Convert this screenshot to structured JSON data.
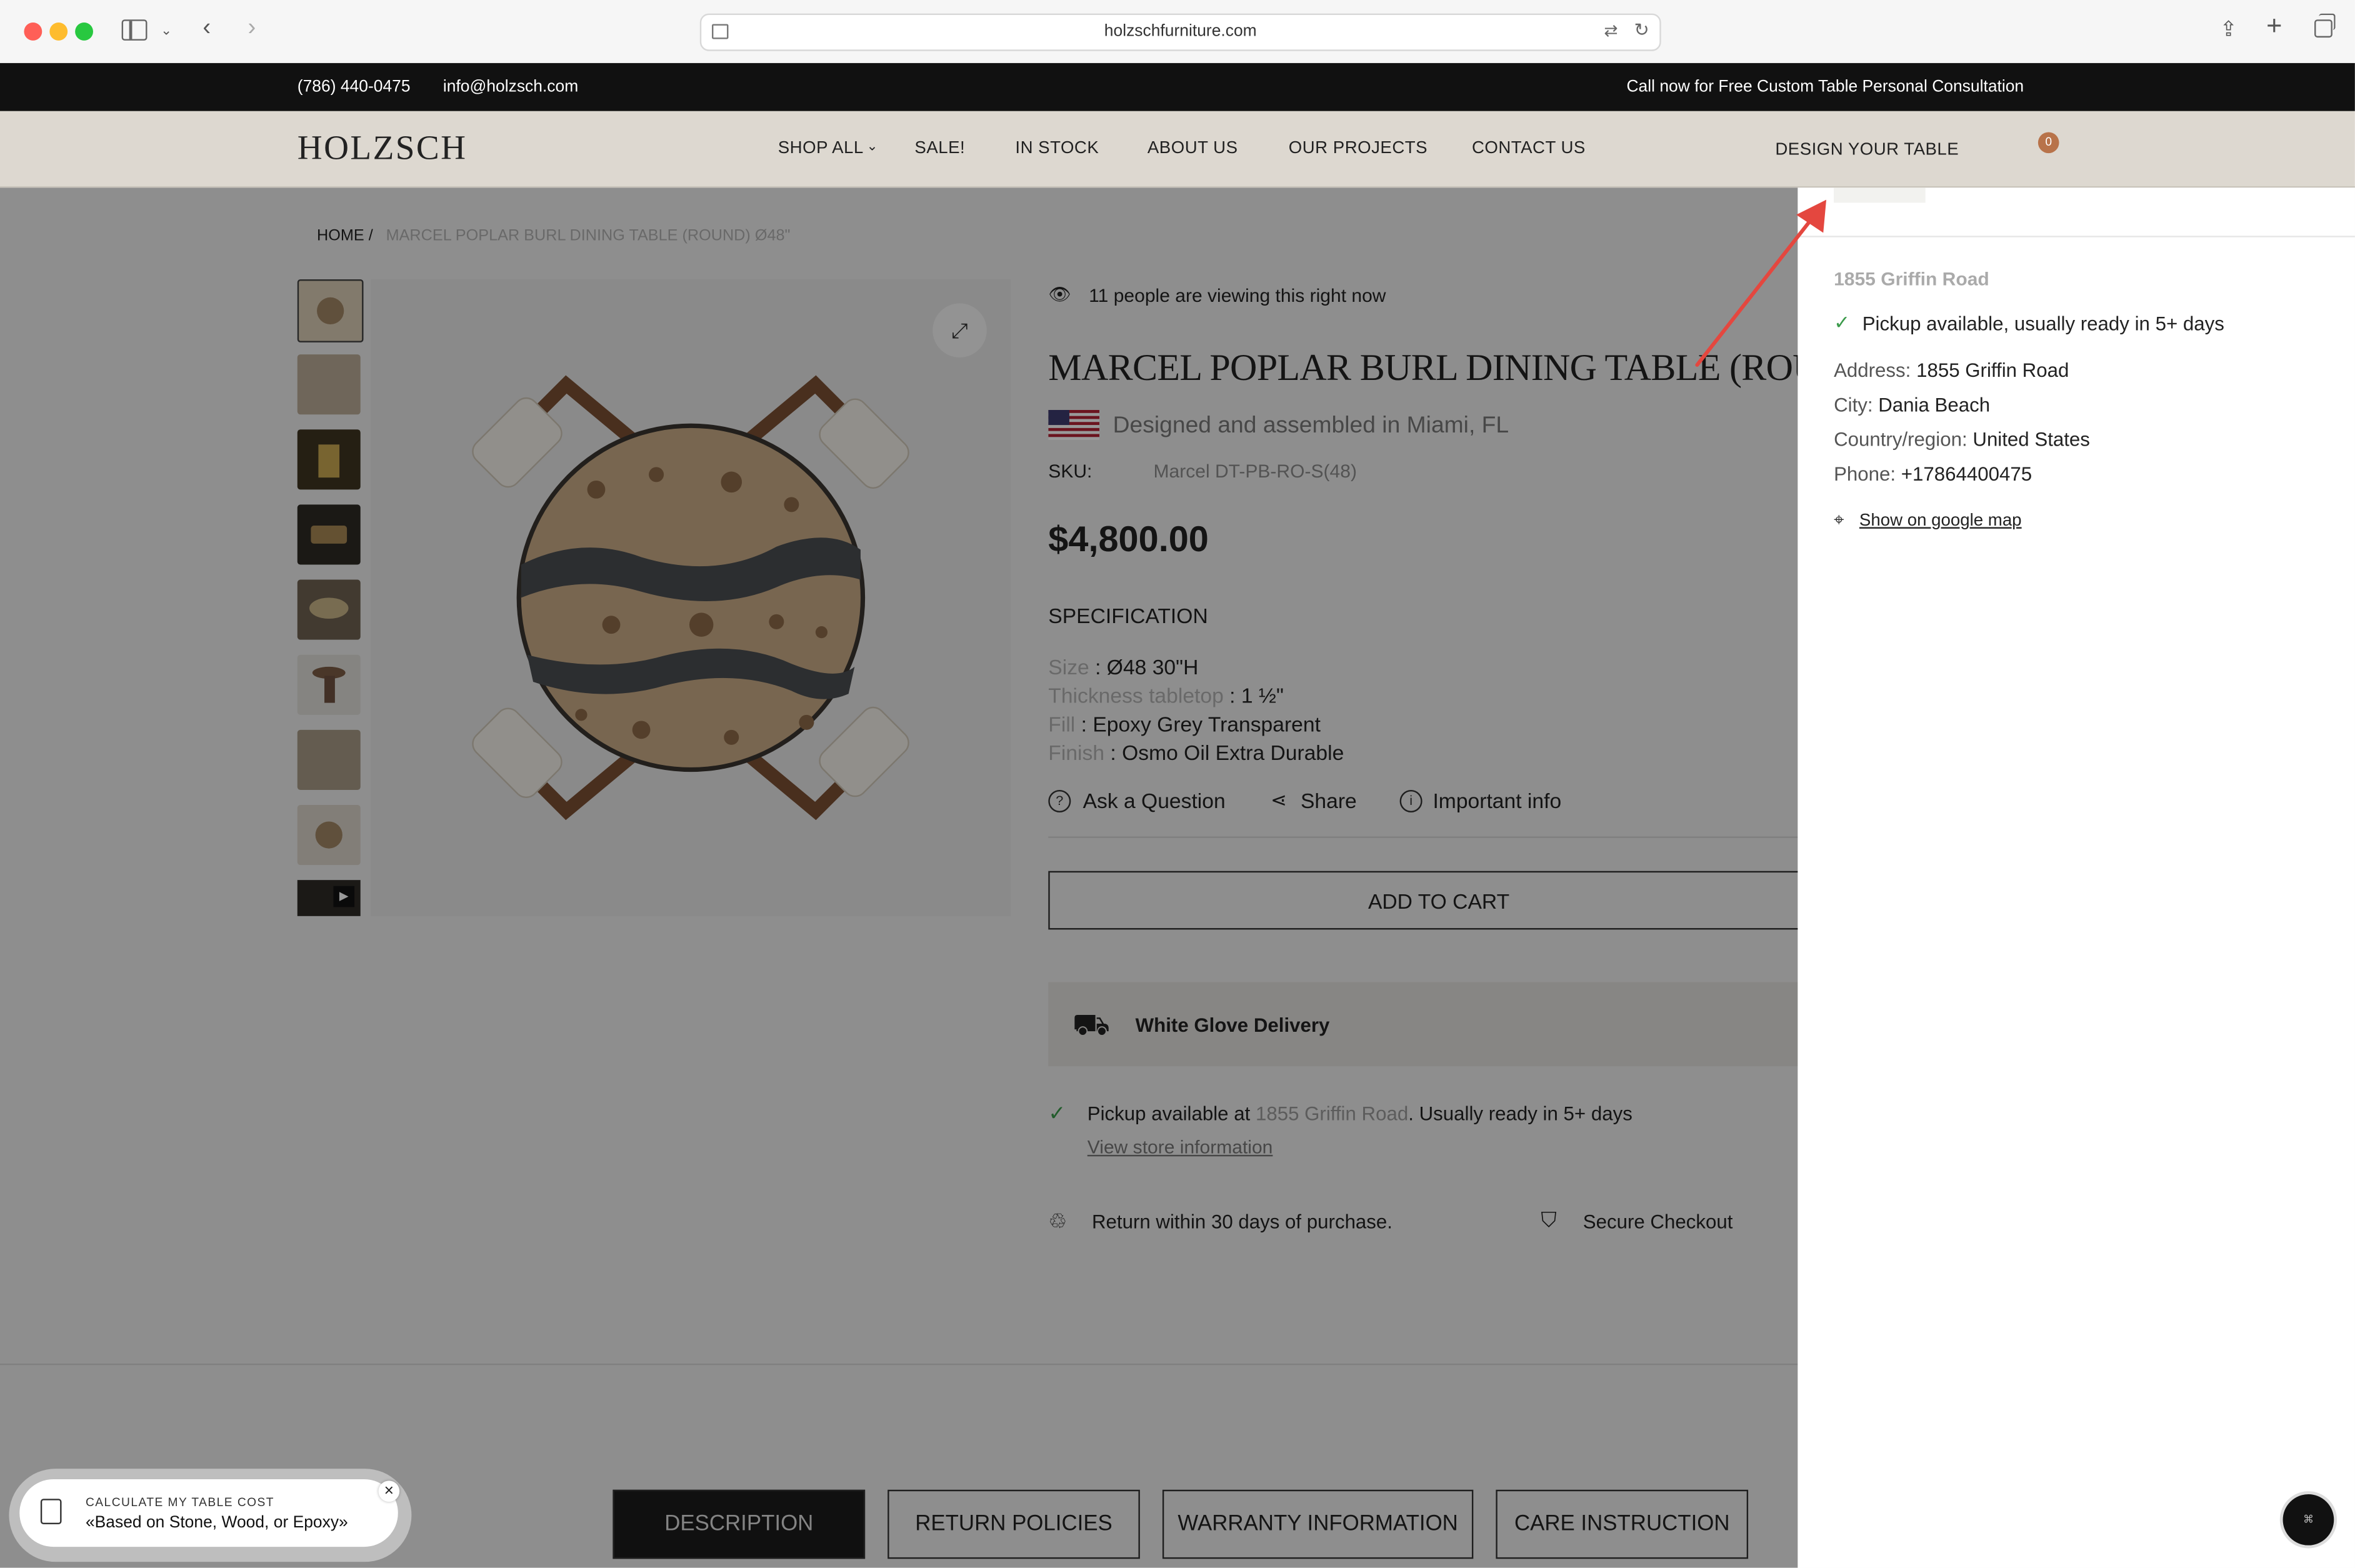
{
  "browser": {
    "url": "holzschfurniture.com"
  },
  "topbar": {
    "phone": "(786) 440-0475",
    "email": "info@holzsch.com",
    "promo": "Call now for Free Custom Table Personal Consultation"
  },
  "nav": {
    "logo": "HOLZSCH",
    "links": [
      "SHOP ALL",
      "SALE!",
      "IN STOCK",
      "ABOUT US",
      "OUR PROJECTS",
      "CONTACT US"
    ],
    "design": "DESIGN YOUR TABLE",
    "cart_count": "0"
  },
  "breadcrumb": {
    "home": "HOME /",
    "current": "MARCEL POPLAR BURL DINING TABLE (ROUND) Ø48\""
  },
  "product": {
    "viewing": "11 people are viewing this right now",
    "title": "MARCEL POPLAR BURL DINING TABLE (ROUND",
    "origin": "Designed and assembled in Miami, FL",
    "sku_label": "SKU:",
    "sku": "Marcel DT-PB-RO-S(48)",
    "price": "$4,800.00",
    "spec_heading": "SPECIFICATION",
    "specs": [
      {
        "label": "Size",
        "value": " : Ø48 30\"H"
      },
      {
        "label": "Thickness tabletop",
        "value": " : 1 ½\""
      },
      {
        "label": "Fill",
        "value": " : Epoxy Grey Transparent"
      },
      {
        "label": "Finish",
        "value": " : Osmo Oil Extra Durable"
      }
    ],
    "actions": [
      "Ask a Question",
      "Share",
      "Important info"
    ],
    "add_to_cart": "ADD TO CART",
    "delivery": "White Glove Delivery",
    "pickup_prefix": "Pickup available at ",
    "pickup_store": "1855 Griffin Road",
    "pickup_suffix": ". Usually ready in 5+ days",
    "view_store": "View store information",
    "returns": "Return within 30 days of purchase.",
    "secure": "Secure Checkout"
  },
  "tabs": [
    "DESCRIPTION",
    "RETURN POLICIES",
    "WARRANTY INFORMATION",
    "CARE INSTRUCTION"
  ],
  "calc": {
    "title": "CALCULATE MY TABLE COST",
    "subtitle": "«Based on Stone, Wood, or Epoxy»"
  },
  "drawer": {
    "store_name": "1855 Griffin Road",
    "pickup": "Pickup available, usually ready in 5+ days",
    "address_label": "Address:",
    "address": "1855 Griffin Road",
    "city_label": "City:",
    "city": "Dania Beach",
    "country_label": "Country/region:",
    "country": "United States",
    "phone_label": "Phone:",
    "phone": "+17864400475",
    "map_link": "Show on google map"
  },
  "colors": {
    "accent_arrow": "#e4473f",
    "cart_badge": "#b8734a",
    "check_green": "#3a9a4a"
  }
}
